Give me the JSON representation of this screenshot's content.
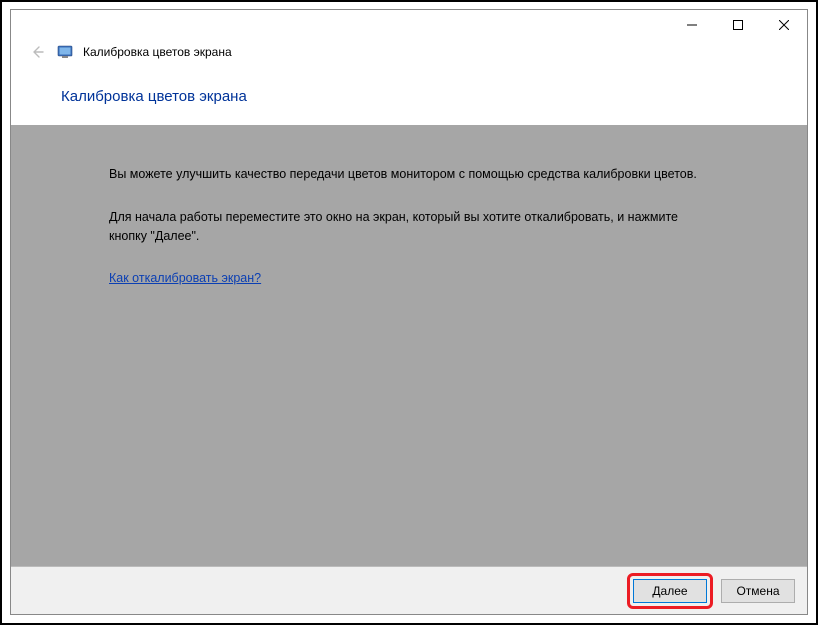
{
  "header": {
    "app_title": "Калибровка цветов экрана"
  },
  "page": {
    "title": "Калибровка цветов экрана"
  },
  "content": {
    "paragraph1": "Вы можете улучшить качество передачи цветов монитором с помощью средства калибровки цветов.",
    "paragraph2": "Для начала работы переместите это окно на экран, который вы хотите откалибровать, и нажмите кнопку \"Далее\".",
    "help_link": "Как откалибровать экран?"
  },
  "footer": {
    "next_label": "Далее",
    "cancel_label": "Отмена"
  }
}
